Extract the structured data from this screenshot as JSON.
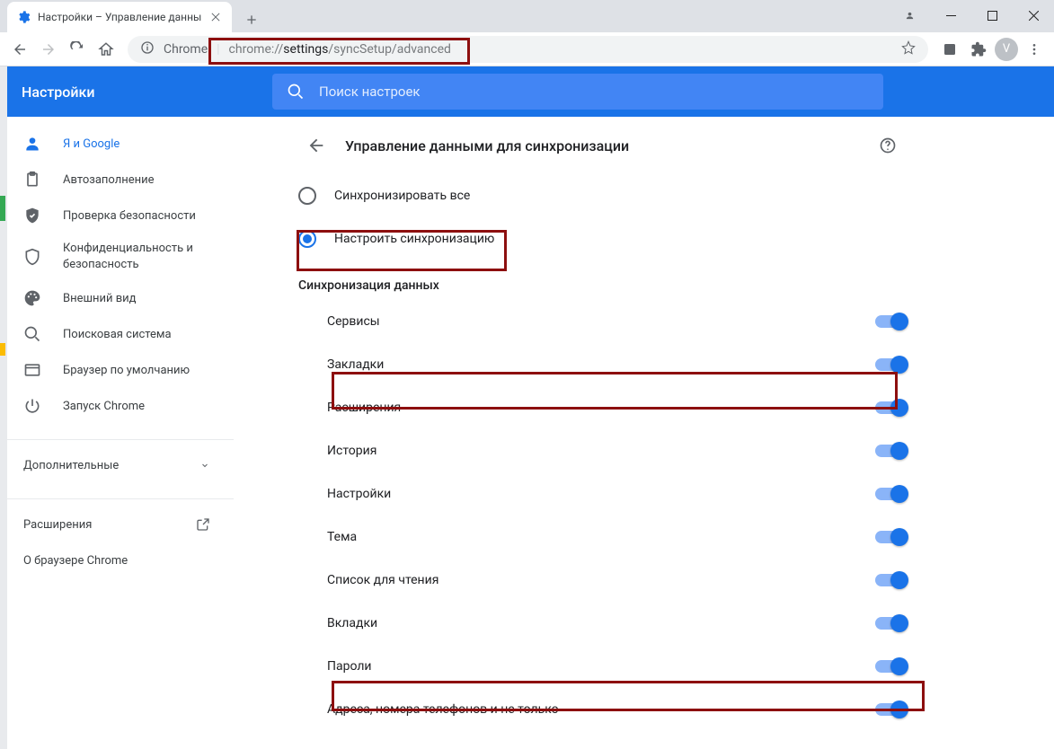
{
  "browser": {
    "tab_title": "Настройки – Управление данны",
    "site_label": "Chrome",
    "url_dark": "settings",
    "url_rest": "/syncSetup/advanced",
    "url_prefix": "chrome://",
    "avatar_letter": "V"
  },
  "header": {
    "title": "Настройки",
    "search_placeholder": "Поиск настроек"
  },
  "sidebar": {
    "items": [
      {
        "icon": "person",
        "label": "Я и Google",
        "active": true
      },
      {
        "icon": "clipboard",
        "label": "Автозаполнение"
      },
      {
        "icon": "shield-check",
        "label": "Проверка безопасности"
      },
      {
        "icon": "shield",
        "label": "Конфиденциальность и безопасность",
        "tall": true
      },
      {
        "icon": "palette",
        "label": "Внешний вид"
      },
      {
        "icon": "search",
        "label": "Поисковая система"
      },
      {
        "icon": "browser",
        "label": "Браузер по умолчанию"
      },
      {
        "icon": "power",
        "label": "Запуск Chrome"
      }
    ],
    "advanced": "Дополнительные",
    "extensions": "Расширения",
    "about": "О браузере Chrome"
  },
  "page": {
    "title": "Управление данными для синхронизации",
    "radio_all": "Синхронизировать все",
    "radio_custom": "Настроить синхронизацию",
    "section_title": "Синхронизация данных",
    "toggles": [
      {
        "label": "Сервисы",
        "on": true
      },
      {
        "label": "Закладки",
        "on": true,
        "highlight": true
      },
      {
        "label": "Расширения",
        "on": true
      },
      {
        "label": "История",
        "on": true
      },
      {
        "label": "Настройки",
        "on": true
      },
      {
        "label": "Тема",
        "on": true
      },
      {
        "label": "Список для чтения",
        "on": true
      },
      {
        "label": "Вкладки",
        "on": true
      },
      {
        "label": "Пароли",
        "on": true,
        "highlight": true
      },
      {
        "label": "Адреса, номера телефонов и не только",
        "on": true
      }
    ]
  }
}
